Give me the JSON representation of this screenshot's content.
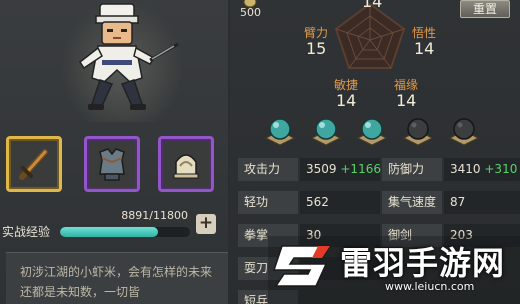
{
  "currency": {
    "value": "500",
    "icon": "coin-icon"
  },
  "reset_button": "重置",
  "radar": {
    "top_value": "14",
    "attributes": [
      {
        "label": "臂力",
        "value": "15"
      },
      {
        "label": "悟性",
        "value": "14"
      },
      {
        "label": "敏捷",
        "value": "14"
      },
      {
        "label": "福缘",
        "value": "14"
      }
    ]
  },
  "orbs": [
    {
      "state": "filled",
      "color": "#3fa7a0"
    },
    {
      "state": "filled",
      "color": "#3fa7a0"
    },
    {
      "state": "filled",
      "color": "#3fa7a0"
    },
    {
      "state": "empty",
      "color": "#3b3d3f"
    },
    {
      "state": "empty",
      "color": "#3b3d3f"
    }
  ],
  "equipment": [
    {
      "name": "sword-icon",
      "rarity_color": "#e0b84a"
    },
    {
      "name": "armor-icon",
      "rarity_color": "#9356c9"
    },
    {
      "name": "accessory-icon",
      "rarity_color": "#9356c9"
    }
  ],
  "experience": {
    "label": "实战经验",
    "value": "8891/11800",
    "progress": 0.7535,
    "add_button": "+"
  },
  "bio": "初涉江湖的小虾米，会有怎样的未来还都是未知数，一切皆",
  "stats": [
    {
      "label": "攻击力",
      "value": "3509",
      "bonus": "+1166"
    },
    {
      "label": "防御力",
      "value": "3410",
      "bonus": "+310"
    },
    {
      "label": "轻功",
      "value": "562",
      "bonus": ""
    },
    {
      "label": "集气速度",
      "value": "87",
      "bonus": ""
    },
    {
      "label": "拳掌",
      "value": "30",
      "bonus": ""
    },
    {
      "label": "御剑",
      "value": "203",
      "bonus": ""
    },
    {
      "label": "耍刀",
      "value": "",
      "bonus": ""
    },
    {
      "label": "短兵",
      "value": "",
      "bonus": ""
    }
  ],
  "watermark": {
    "title": "雷羽手游网",
    "url": "www.leiucn.com"
  }
}
